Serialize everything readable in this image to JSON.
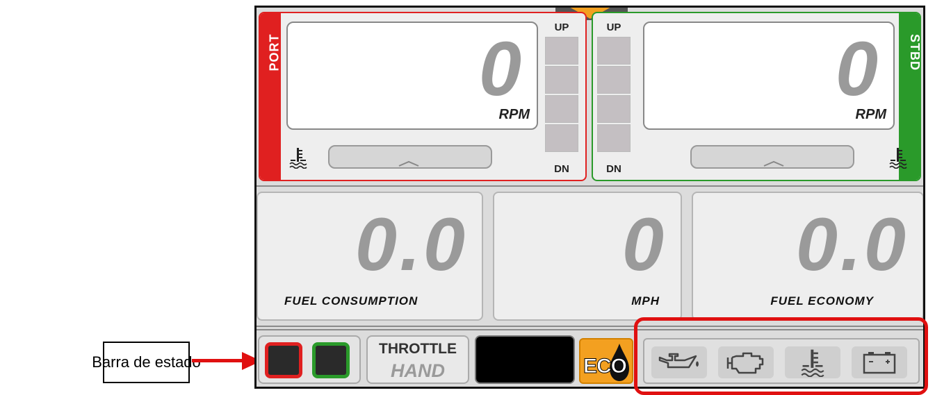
{
  "annotation": {
    "callout_label": "Barra de estado",
    "highlight_color": "#e01010"
  },
  "port": {
    "label": "PORT",
    "color": "#e02020",
    "rpm_value": "0",
    "rpm_unit": "RPM",
    "trim_up": "UP",
    "trim_dn": "DN"
  },
  "stbd": {
    "label": "STBD",
    "color": "#2a9a2a",
    "rpm_value": "0",
    "rpm_unit": "RPM",
    "trim_up": "UP",
    "trim_dn": "DN"
  },
  "gauges": {
    "fuel_consumption": {
      "value": "0.0",
      "label": "FUEL CONSUMPTION"
    },
    "speed": {
      "value": "0",
      "label": "MPH"
    },
    "fuel_economy": {
      "value": "0.0",
      "label": "FUEL ECONOMY"
    }
  },
  "status_bar": {
    "throttle_title": "THROTTLE",
    "throttle_mode": "HAND",
    "eco_label": "ECO",
    "eco_color": "#f3a020",
    "warning_icons": [
      "oil-pressure-icon",
      "check-engine-icon",
      "water-temp-icon",
      "battery-icon"
    ]
  }
}
